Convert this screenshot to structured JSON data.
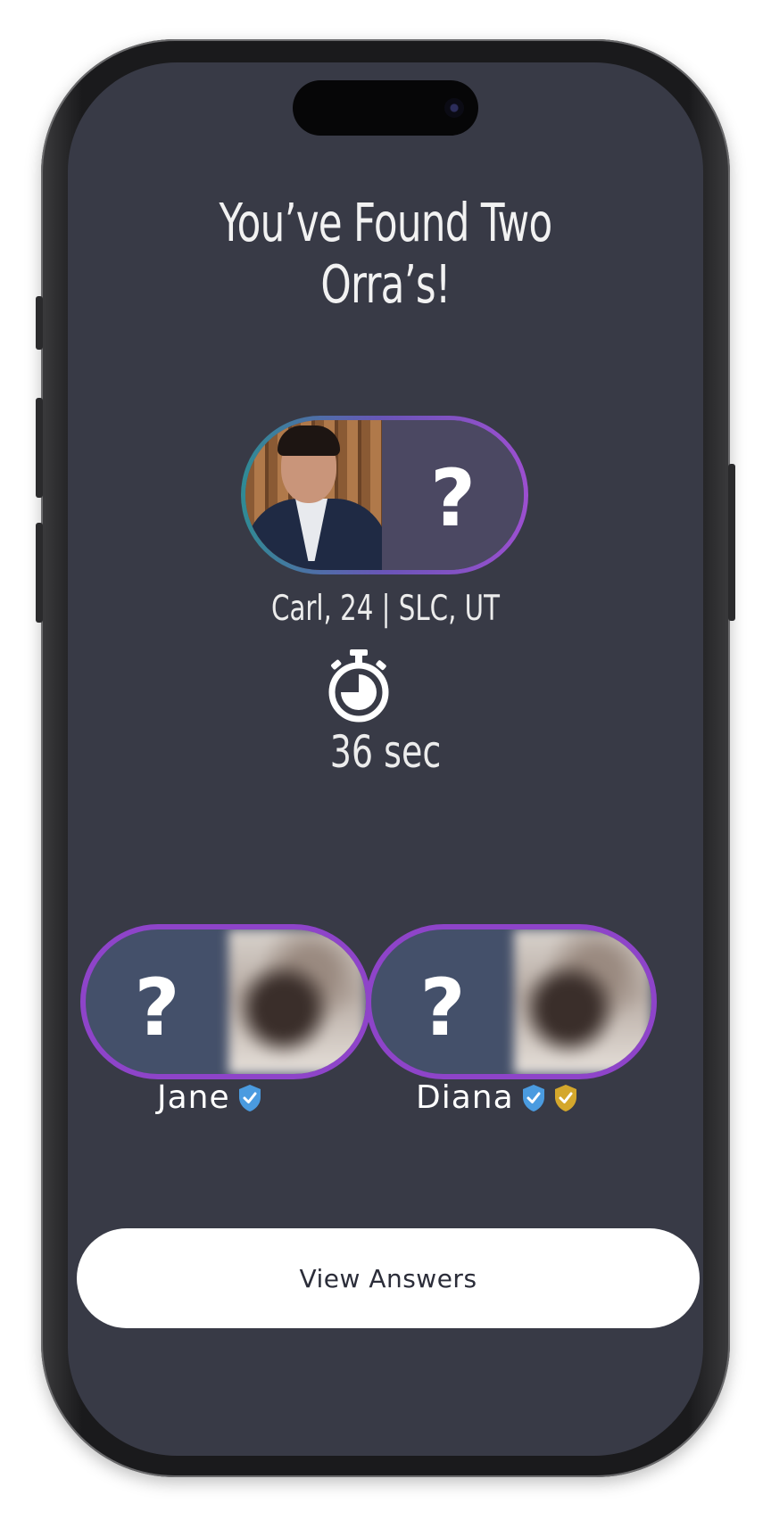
{
  "title": "You’ve Found Two Orra’s!",
  "profile": {
    "caption": "Carl, 24 | SLC, UT",
    "unknown_symbol": "?"
  },
  "timer": {
    "icon": "stopwatch-icon",
    "label": "36 sec"
  },
  "matches": [
    {
      "name": "Jane",
      "unknown_symbol": "?",
      "badges": [
        "blue-verified-shield-icon"
      ]
    },
    {
      "name": "Diana",
      "unknown_symbol": "?",
      "badges": [
        "blue-verified-shield-icon",
        "gold-verified-shield-icon"
      ]
    }
  ],
  "actions": {
    "view_answers": "View Answers"
  },
  "colors": {
    "background": "#383a46",
    "accent_purple": "#8e44c9",
    "badge_blue": "#4a9be0",
    "badge_gold": "#d4a72c",
    "button_bg": "#ffffff",
    "button_text": "#2b2d39"
  }
}
